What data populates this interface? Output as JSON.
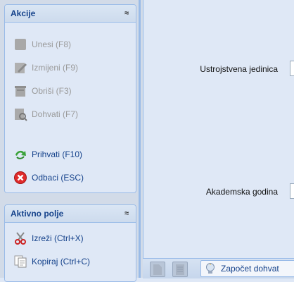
{
  "actions_panel": {
    "title": "Akcije",
    "collapse_glyph": "≈",
    "items": [
      {
        "label": "Unesi (F8)",
        "icon": "add-icon",
        "enabled": false
      },
      {
        "label": "Izmijeni (F9)",
        "icon": "edit-icon",
        "enabled": false
      },
      {
        "label": "Obriši (F3)",
        "icon": "delete-icon",
        "enabled": false
      },
      {
        "label": "Dohvati (F7)",
        "icon": "search-icon",
        "enabled": false
      },
      {
        "label": "Prihvati (F10)",
        "icon": "accept-icon",
        "enabled": true
      },
      {
        "label": "Odbaci (ESC)",
        "icon": "cancel-icon",
        "enabled": true
      }
    ]
  },
  "active_field_panel": {
    "title": "Aktivno polje",
    "collapse_glyph": "≈",
    "items": [
      {
        "label": "Izreži (Ctrl+X)",
        "icon": "cut-icon"
      },
      {
        "label": "Kopiraj (Ctrl+C)",
        "icon": "copy-icon"
      }
    ]
  },
  "form": {
    "unit_label": "Ustrojstvena jedinica",
    "year_label": "Akademska godina"
  },
  "status_bar": {
    "status_text": "Započet dohvat"
  },
  "colors": {
    "accent_text": "#15428b",
    "panel_border": "#99bbe8",
    "background": "#dfe8f6"
  }
}
